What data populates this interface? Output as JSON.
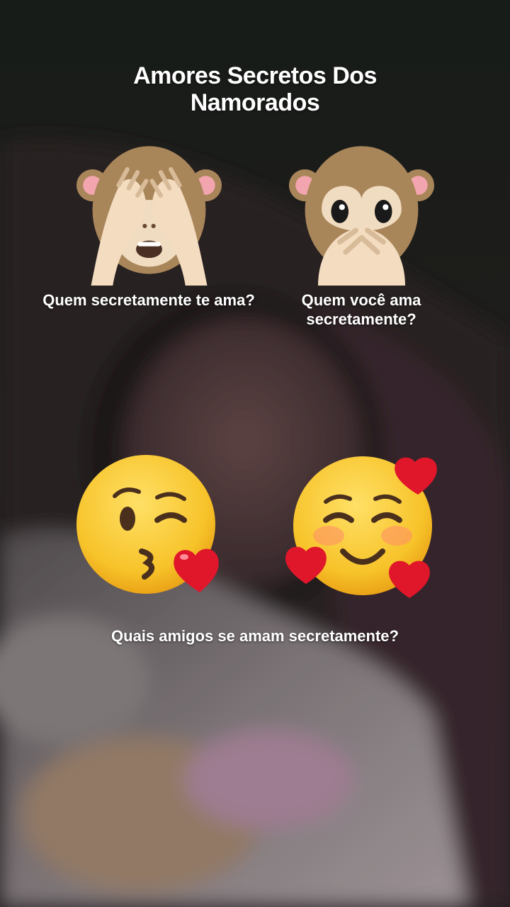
{
  "title": "Amores Secretos Dos Namorados",
  "questions": {
    "left_top": "Quem secretamente te ama?",
    "right_top": "Quem você ama secretamente?",
    "bottom": "Quais amigos se amam secretamente?"
  },
  "emojis": [
    {
      "name": "see-no-evil-monkey",
      "icon": "see-no-evil-monkey-icon"
    },
    {
      "name": "speak-no-evil-monkey",
      "icon": "speak-no-evil-monkey-icon"
    },
    {
      "name": "kissing-face",
      "icon": "face-blowing-a-kiss-icon"
    },
    {
      "name": "smiling-face-with-hearts",
      "icon": "smiling-face-with-hearts-icon"
    }
  ],
  "colors": {
    "background": "#1d1a1c",
    "text": "#ffffff",
    "heart": "#e0162b",
    "face": "#f7c32a",
    "monkey_fur": "#a9855a"
  }
}
